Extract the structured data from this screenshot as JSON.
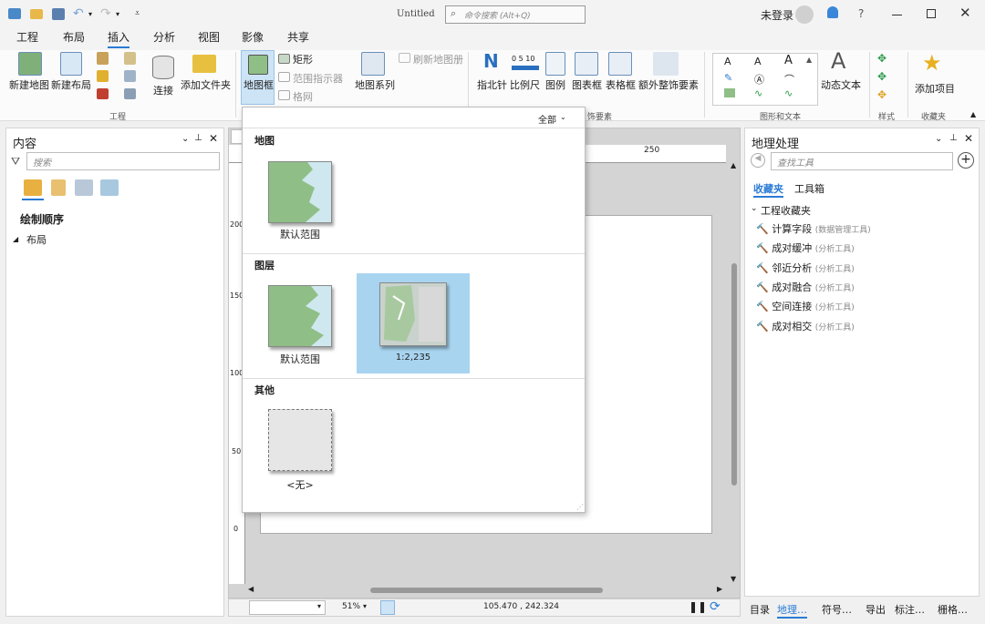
{
  "title_bar": {
    "doc_title": "Untitled",
    "command_search_placeholder": "命令搜索 (Alt+Q)",
    "user": "未登录",
    "help": "?"
  },
  "menu_tabs": [
    "工程",
    "布局",
    "插入",
    "分析",
    "视图",
    "影像",
    "共享"
  ],
  "active_tab": "插入",
  "ribbon": {
    "project": {
      "new_map": "新建地图",
      "new_layout": "新建布局",
      "connect": "连接",
      "add_folder": "添加文件夹",
      "group": "工程"
    },
    "map_frame": "地图框",
    "rectangle": "矩形",
    "extent_indicator": "范围指示器",
    "grid": "格网",
    "refresh_map_series": "刷新地图册",
    "map_series": "地图系列",
    "north_arrow": "指北针",
    "scale_bar": "比例尺",
    "scale_bar_numbers": "0 5 10",
    "legend": "图例",
    "chart_frame": "图表框",
    "table_frame": "表格框",
    "extra_surround": "额外整饰要素",
    "surround_group": "饰要素",
    "dynamic_text": "动态文本",
    "graphics_group": "图形和文本",
    "style_group": "样式",
    "add_item": "添加项目",
    "favorites_group": "收藏夹"
  },
  "contents": {
    "title": "内容",
    "search_placeholder": "搜索",
    "draw_order": "绘制顺序",
    "layout_item": "布局"
  },
  "dropdown": {
    "filter": "全部",
    "sections": [
      {
        "title": "地图",
        "items": [
          "默认范围"
        ]
      },
      {
        "title": "图层",
        "items": [
          "默认范围",
          "1:2,235"
        ]
      },
      {
        "title": "其他",
        "items": [
          "<无>"
        ]
      }
    ]
  },
  "ruler": {
    "top_label": "250",
    "left_labels": [
      "200",
      "150",
      "100",
      "50",
      "0"
    ]
  },
  "status": {
    "zoom": "51%",
    "coords": "105.470 , 242.324"
  },
  "geoprocessing": {
    "title": "地理处理",
    "search_placeholder": "查找工具",
    "tab_favorites": "收藏夹",
    "tab_toolboxes": "工具箱",
    "section": "工程收藏夹",
    "tools": [
      {
        "name": "计算字段",
        "box": "(数据管理工具)"
      },
      {
        "name": "成对缓冲",
        "box": "(分析工具)"
      },
      {
        "name": "邻近分析",
        "box": "(分析工具)"
      },
      {
        "name": "成对融合",
        "box": "(分析工具)"
      },
      {
        "name": "空间连接",
        "box": "(分析工具)"
      },
      {
        "name": "成对相交",
        "box": "(分析工具)"
      }
    ]
  },
  "bottom_tabs": [
    "目录",
    "地理…",
    "符号…",
    "导出",
    "标注…",
    "栅格…"
  ],
  "colors": {
    "accent": "#2a7bd5",
    "map_green": "#8fbf86",
    "map_water": "#cfe8ef",
    "selected_bg": "#a9d4f0"
  }
}
